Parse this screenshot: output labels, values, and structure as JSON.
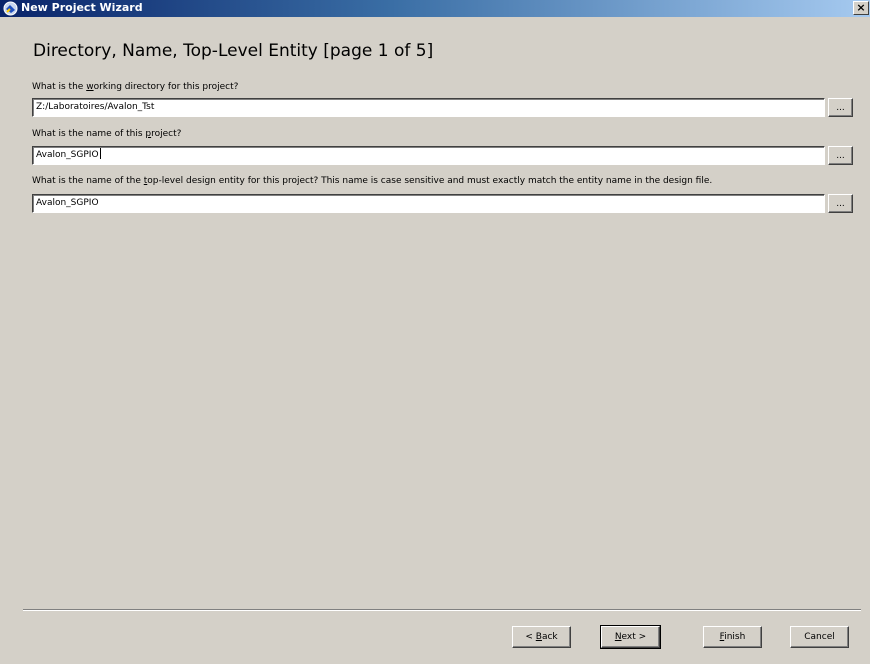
{
  "window": {
    "title": "New Project Wizard",
    "close_label": "×"
  },
  "page": {
    "heading": "Directory, Name, Top-Level Entity [page 1 of 5]"
  },
  "fields": [
    {
      "label_prefix": "What is the ",
      "label_mnemonic": "w",
      "label_suffix": "orking directory for this project?",
      "value": "Z:/Laboratoires/Avalon_Tst",
      "browse_label": "..."
    },
    {
      "label_prefix": "What is the name of this ",
      "label_mnemonic": "p",
      "label_suffix": "roject?",
      "value": "Avalon_SGPIO",
      "browse_label": "..."
    },
    {
      "label_prefix": "What is the name of the ",
      "label_mnemonic": "t",
      "label_suffix": "op-level design entity for this project? This name is case sensitive and must exactly match the entity name in the design file.",
      "value": "Avalon_SGPIO",
      "browse_label": "..."
    }
  ],
  "buttons": {
    "back": {
      "prefix": "< ",
      "mnemonic": "B",
      "suffix": "ack"
    },
    "next": {
      "prefix": "",
      "mnemonic": "N",
      "suffix": "ext >"
    },
    "finish": {
      "prefix": "",
      "mnemonic": "F",
      "suffix": "inish"
    },
    "cancel": {
      "label": "Cancel"
    }
  },
  "colors": {
    "titlebar_start": "#0a246a",
    "titlebar_end": "#a6caf0",
    "dialog_background": "#d4d0c8"
  },
  "icons": {
    "title_icon": "quartus-wizard-icon"
  }
}
